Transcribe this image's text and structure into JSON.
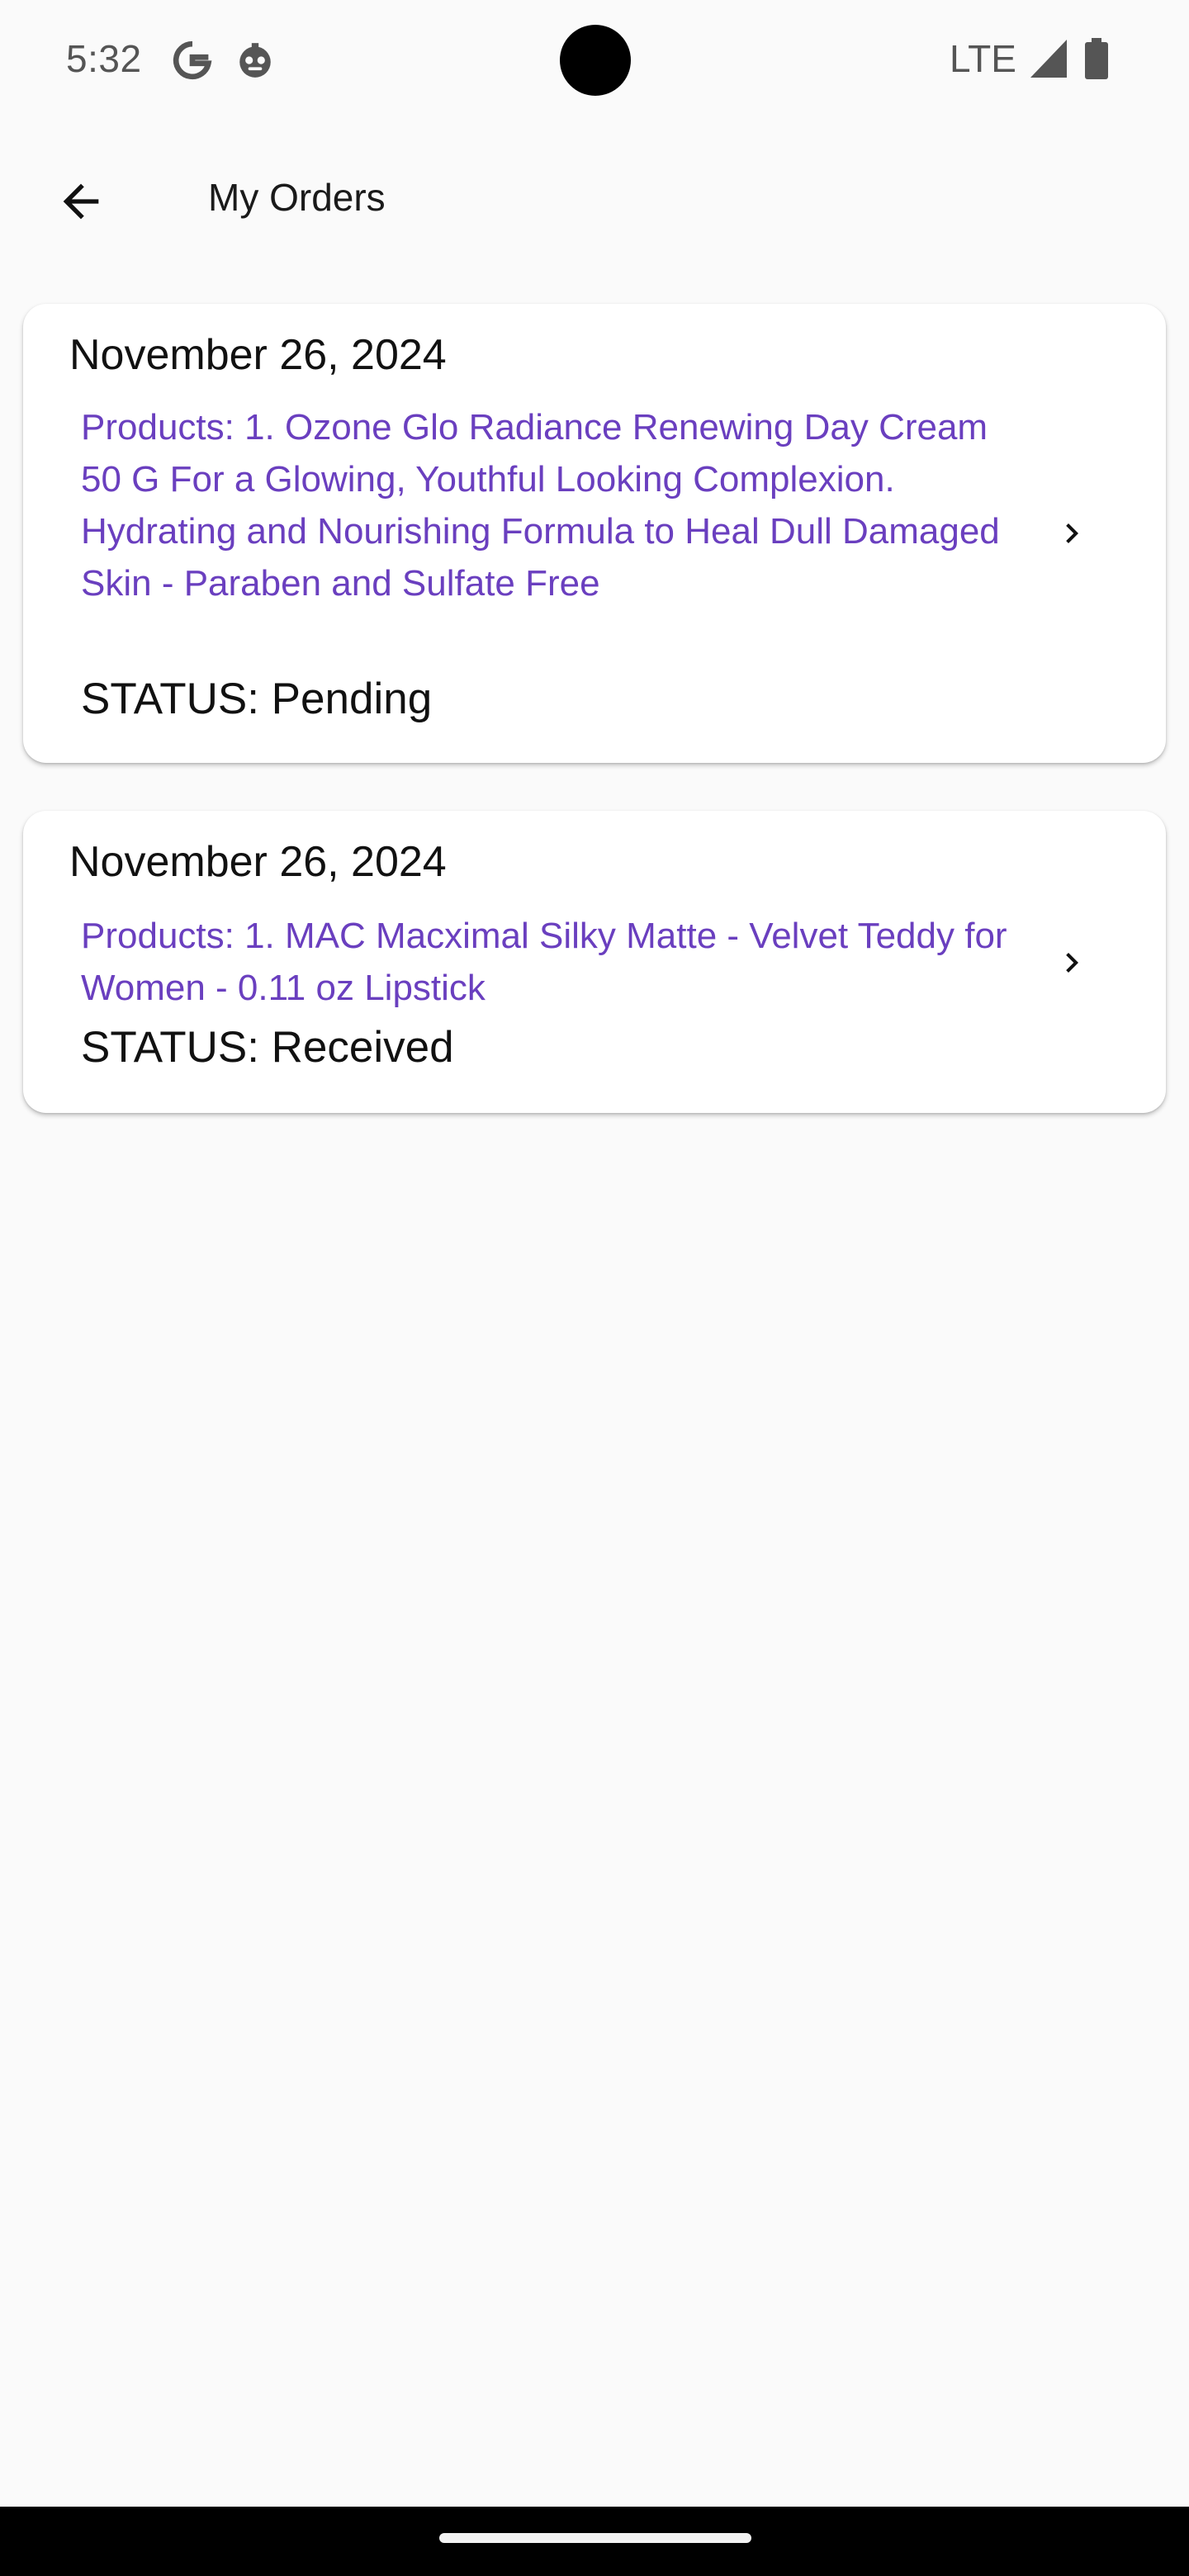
{
  "status_bar": {
    "time": "5:32",
    "network": "LTE",
    "icons": [
      "google-g-icon",
      "bot-face-icon",
      "signal-icon",
      "battery-icon"
    ]
  },
  "app_bar": {
    "title": "My Orders",
    "back_icon": "arrow-back-icon"
  },
  "orders": [
    {
      "date": "November 26, 2024",
      "products": "Products: 1. Ozone Glo Radiance Renewing Day Cream 50 G For a Glowing, Youthful Looking Complexion. Hydrating and Nourishing Formula to Heal Dull Damaged Skin - Paraben and Sulfate Free",
      "status": "STATUS: Pending"
    },
    {
      "date": "November 26, 2024",
      "products": "Products: 1. MAC Macximal Silky Matte - Velvet Teddy for Women - 0.11 oz Lipstick",
      "status": "STATUS: Received"
    }
  ],
  "colors": {
    "background": "#fafafa",
    "card": "#ffffff",
    "product_text": "#6a3fbf",
    "nav_bar": "#000000"
  }
}
